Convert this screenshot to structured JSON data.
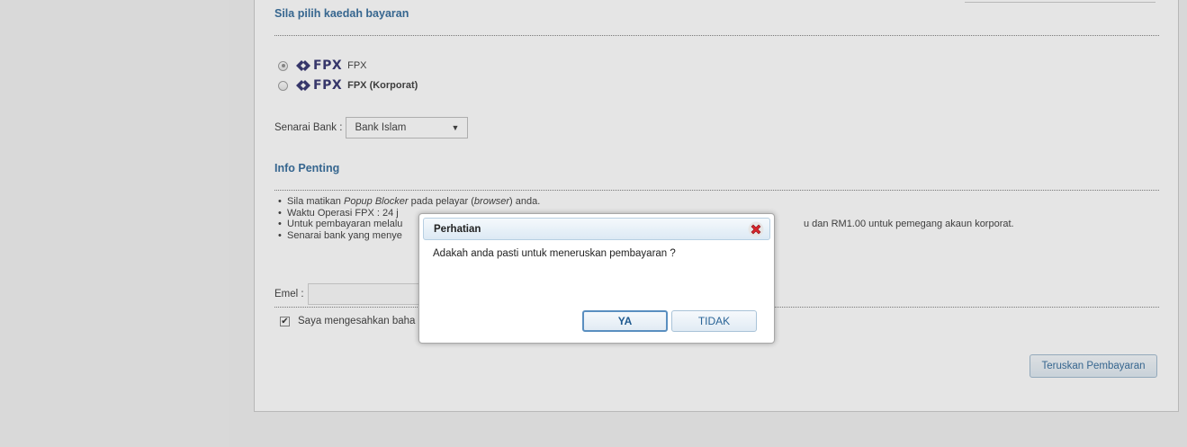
{
  "payment_method": {
    "title": "Sila pilih kaedah bayaran",
    "options": [
      {
        "logo": "FPX",
        "label": "FPX",
        "selected": true
      },
      {
        "logo": "FPX",
        "label": "FPX (Korporat)",
        "selected": false
      }
    ]
  },
  "bank": {
    "label": "Senarai Bank :",
    "selected": "Bank Islam"
  },
  "info": {
    "title": "Info Penting",
    "items": {
      "popup": {
        "pre": "Sila matikan ",
        "em1": "Popup Blocker",
        "mid": " pada pelayar (",
        "em2": "browser",
        "post": ") anda."
      },
      "hours": "Waktu Operasi FPX : 24 j",
      "fee_start": "Untuk pembayaran melalu",
      "fee_end": "u dan RM1.00 untuk pemegang akaun korporat.",
      "banks": "Senarai bank yang menye"
    }
  },
  "email": {
    "label": "Emel :",
    "value": ""
  },
  "confirm": {
    "label": "Saya mengesahkan baha",
    "checked": true
  },
  "proceed_button": "Teruskan Pembayaran",
  "dialog": {
    "title": "Perhatian",
    "message": "Adakah anda pasti untuk meneruskan pembayaran ?",
    "yes": "YA",
    "no": "TIDAK"
  },
  "colors": {
    "accent": "#2a6496",
    "close": "#d9242a"
  }
}
